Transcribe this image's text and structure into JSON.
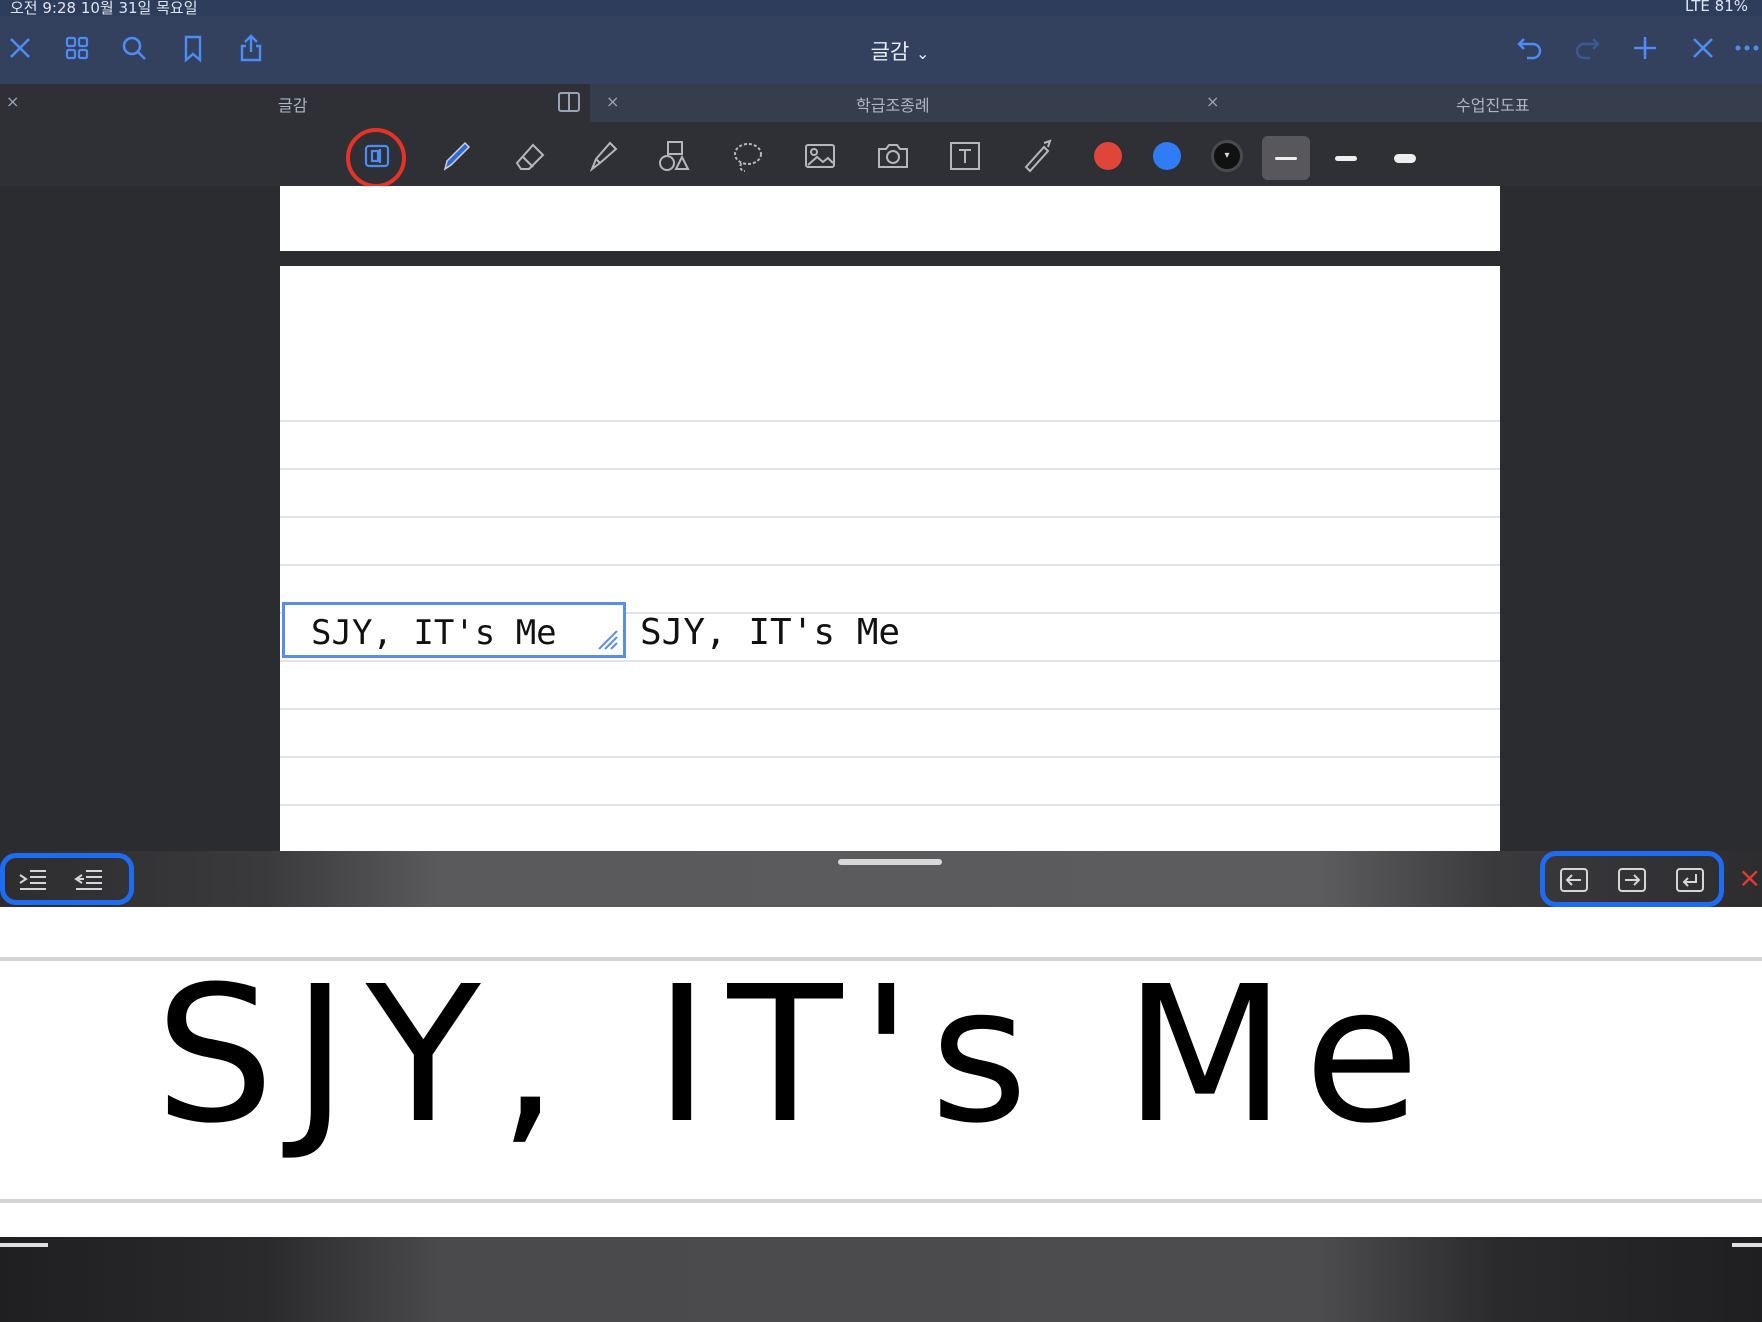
{
  "status_bar": {
    "time_date": "오전 9:28   10월 31일 목요일",
    "indicators": "LTE  81%"
  },
  "top_nav": {
    "title": "글감",
    "title_chevron": "⌄",
    "left_icons": [
      "close-icon",
      "grid-icon",
      "search-icon",
      "bookmark-icon",
      "share-icon"
    ],
    "right_icons": [
      "undo-icon",
      "redo-icon",
      "plus-icon",
      "close-icon",
      "more-icon"
    ]
  },
  "tabs": [
    {
      "label": "글감",
      "close": "×"
    },
    {
      "label": "학급조종례",
      "close": "×"
    },
    {
      "label": "수업진도표",
      "close": "×"
    }
  ],
  "toolbar": {
    "tools": [
      "handwriting-input-icon",
      "pen-icon",
      "eraser-icon",
      "highlighter-icon",
      "shapes-icon",
      "lasso-icon",
      "image-icon",
      "camera-icon",
      "text-box-icon",
      "laser-pointer-icon"
    ],
    "colors": [
      "#e0453a",
      "#2f7cf6",
      "#111111"
    ],
    "accent_annotation": "#e53326",
    "blue_annotation": "#1f6cf2"
  },
  "page": {
    "selected_text": "SJY, IT's Me",
    "converted_text": "SJY, IT's Me"
  },
  "input_panel": {
    "left_buttons": [
      "indent-icon",
      "outdent-icon"
    ],
    "right_buttons": [
      "arrow-left-icon",
      "arrow-right-icon",
      "return-icon"
    ],
    "close": "×",
    "handwriting": "SJY, IT's Me"
  }
}
